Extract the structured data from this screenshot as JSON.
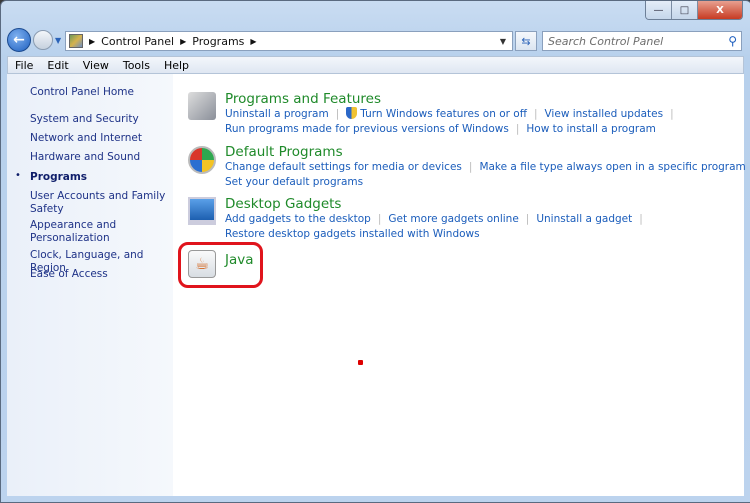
{
  "window": {
    "minimize": "—",
    "maximize": "□",
    "close": "X"
  },
  "address": {
    "crumbs": [
      "Control Panel",
      "Programs"
    ]
  },
  "search": {
    "placeholder": "Search Control Panel"
  },
  "menu": [
    "File",
    "Edit",
    "View",
    "Tools",
    "Help"
  ],
  "sidebar": {
    "home": "Control Panel Home",
    "items": [
      {
        "label": "System and Security"
      },
      {
        "label": "Network and Internet"
      },
      {
        "label": "Hardware and Sound"
      },
      {
        "label": "Programs",
        "current": true
      },
      {
        "label": "User Accounts and Family Safety"
      },
      {
        "label": "Appearance and Personalization"
      },
      {
        "label": "Clock, Language, and Region"
      },
      {
        "label": "Ease of Access"
      }
    ]
  },
  "categories": [
    {
      "title": "Programs and Features",
      "links": [
        "Uninstall a program",
        "Turn Windows features on or off",
        "View installed updates",
        "Run programs made for previous versions of Windows",
        "How to install a program"
      ]
    },
    {
      "title": "Default Programs",
      "links": [
        "Change default settings for media or devices",
        "Make a file type always open in a specific program",
        "Set your default programs"
      ]
    },
    {
      "title": "Desktop Gadgets",
      "links": [
        "Add gadgets to the desktop",
        "Get more gadgets online",
        "Uninstall a gadget",
        "Restore desktop gadgets installed with Windows"
      ]
    },
    {
      "title": "Java",
      "links": []
    }
  ],
  "colors": {
    "category_title": "#1f8a2a",
    "link": "#1b5dbb",
    "highlight": "#e0141c"
  }
}
